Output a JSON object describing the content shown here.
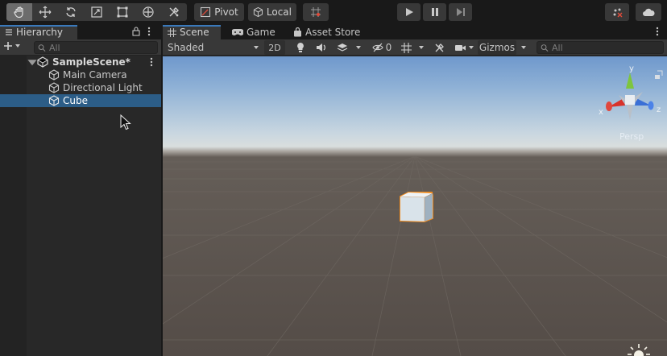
{
  "toolbar": {
    "tools": [
      "hand-tool",
      "move-tool",
      "rotate-tool",
      "scale-tool",
      "rect-tool",
      "transform-tool",
      "custom-tool"
    ],
    "pivot_label": "Pivot",
    "local_label": "Local",
    "play_controls": [
      "play",
      "pause",
      "step"
    ]
  },
  "hierarchy": {
    "tab_label": "Hierarchy",
    "search_placeholder": "All",
    "scene_name": "SampleScene*",
    "items": [
      {
        "label": "Main Camera",
        "selected": false
      },
      {
        "label": "Directional Light",
        "selected": false
      },
      {
        "label": "Cube",
        "selected": true
      }
    ]
  },
  "scene_view": {
    "tabs": [
      {
        "label": "Scene",
        "icon": "grid-icon",
        "active": true
      },
      {
        "label": "Game",
        "icon": "gamepad-icon",
        "active": false
      },
      {
        "label": "Asset Store",
        "icon": "bag-icon",
        "active": false
      }
    ],
    "shading_mode": "Shaded",
    "mode_2d_label": "2D",
    "hidden_count": "0",
    "gizmos_label": "Gizmos",
    "search_placeholder": "All",
    "projection_label": "Persp",
    "axis_labels": {
      "x": "x",
      "y": "y",
      "z": "z"
    }
  },
  "colors": {
    "selection": "#2c5d87",
    "accent_tab": "#3a79bb",
    "cube_outline": "#f08a1c",
    "axis_x": "#d8322a",
    "axis_y": "#7ec53e",
    "axis_z": "#3a6fd6"
  }
}
